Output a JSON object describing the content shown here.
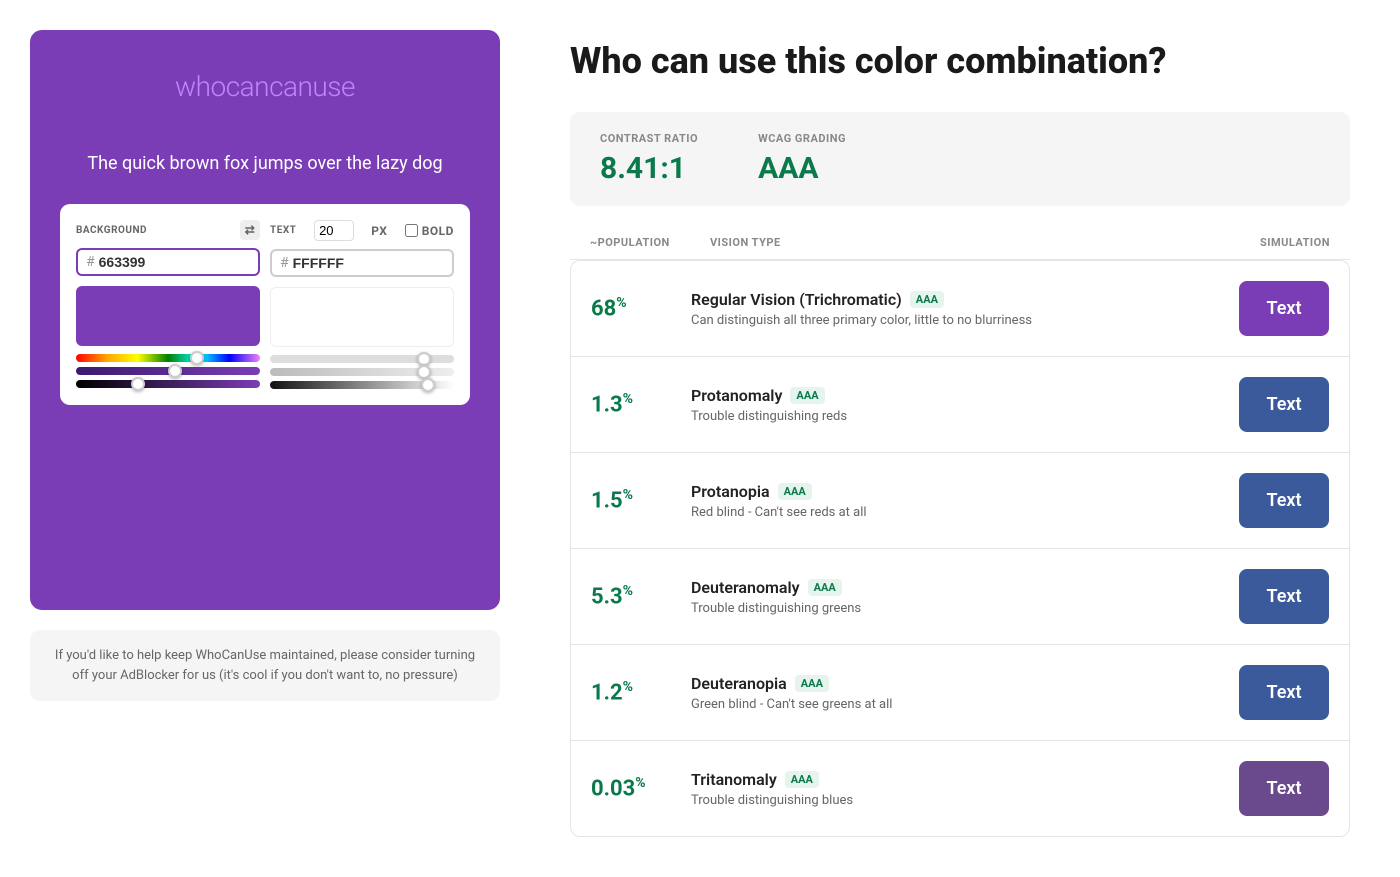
{
  "logo": {
    "who": "who",
    "canuse": "canuse"
  },
  "preview": {
    "text": "The quick brown fox jumps over the lazy dog"
  },
  "background_control": {
    "label": "BACKGROUND",
    "hex_value": "663399"
  },
  "text_control": {
    "label": "TEXT",
    "size": "20",
    "unit": "PX",
    "bold_label": "BOLD",
    "hex_value": "FFFFFF"
  },
  "adblock_notice": "If you'd like to help keep WhoCanUse maintained, please consider turning off your AdBlocker for us (it's cool if you don't want to, no pressure)",
  "page": {
    "title": "Who can use this color combination?"
  },
  "stats": {
    "contrast_ratio_label": "CONTRAST RATIO",
    "contrast_ratio_value": "8.41:1",
    "wcag_label": "WCAG GRADING",
    "wcag_value": "AAA"
  },
  "table_headers": {
    "population": "~POPULATION",
    "vision_type": "VISION TYPE",
    "simulation": "SIMULATION"
  },
  "vision_rows": [
    {
      "population": "68",
      "pct_sup": "%",
      "name": "Regular Vision (Trichromatic)",
      "badge": "AAA",
      "description": "Can distinguish all three primary color, little to no blurriness",
      "button_label": "Text",
      "button_bg": "#7b3db5"
    },
    {
      "population": "1.3",
      "pct_sup": "%",
      "name": "Protanomaly",
      "badge": "AAA",
      "description": "Trouble distinguishing reds",
      "button_label": "Text",
      "button_bg": "#3a5a9b"
    },
    {
      "population": "1.5",
      "pct_sup": "%",
      "name": "Protanopia",
      "badge": "AAA",
      "description": "Red blind - Can't see reds at all",
      "button_label": "Text",
      "button_bg": "#3a5a9b"
    },
    {
      "population": "5.3",
      "pct_sup": "%",
      "name": "Deuteranomaly",
      "badge": "AAA",
      "description": "Trouble distinguishing greens",
      "button_label": "Text",
      "button_bg": "#3a5a9b"
    },
    {
      "population": "1.2",
      "pct_sup": "%",
      "name": "Deuteranopia",
      "badge": "AAA",
      "description": "Green blind - Can't see greens at all",
      "button_label": "Text",
      "button_bg": "#3a5a9b"
    },
    {
      "population": "0.03",
      "pct_sup": "%",
      "name": "Tritanomaly",
      "badge": "AAA",
      "description": "Trouble distinguishing blues",
      "button_label": "Text",
      "button_bg": "#6a4a8c"
    }
  ]
}
